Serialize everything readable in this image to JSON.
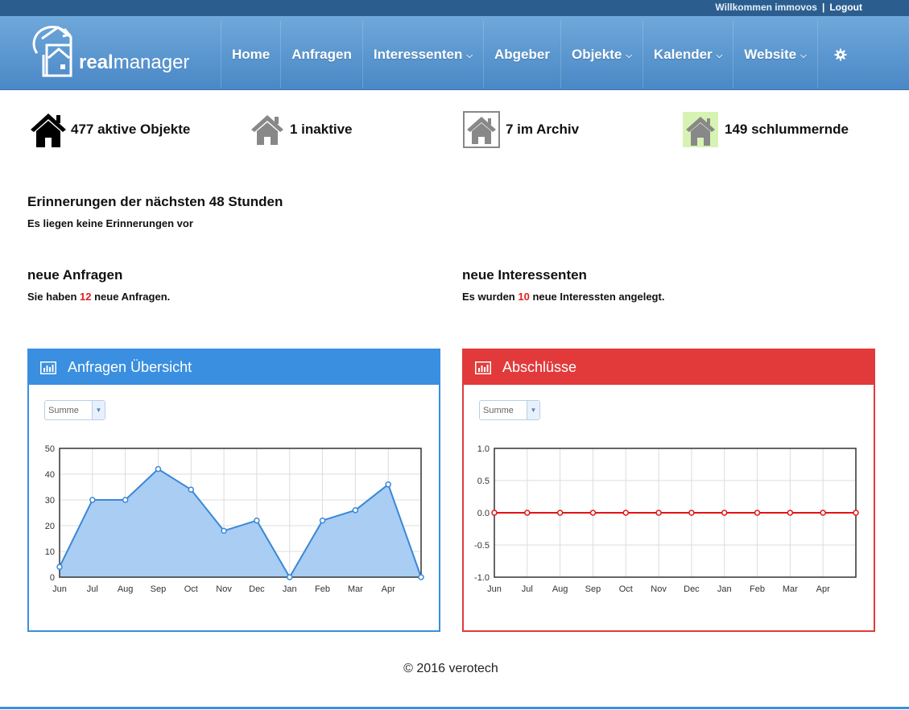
{
  "topbar": {
    "welcome": "Willkommen immovos",
    "separator": "|",
    "logout": "Logout"
  },
  "logo": {
    "prefix": "real",
    "suffix": "manager"
  },
  "nav": [
    {
      "label": "Home",
      "dropdown": false
    },
    {
      "label": "Anfragen",
      "dropdown": false
    },
    {
      "label": "Interessenten",
      "dropdown": true
    },
    {
      "label": "Abgeber",
      "dropdown": false
    },
    {
      "label": "Objekte",
      "dropdown": true
    },
    {
      "label": "Kalender",
      "dropdown": true
    },
    {
      "label": "Website",
      "dropdown": true
    }
  ],
  "nav_chevron": "⌄",
  "settings_icon": "gear-icon",
  "stats": {
    "active": "477 aktive Objekte",
    "inactive": "1 inaktive",
    "archive": "7 im Archiv",
    "sleeping": "149 schlummernde"
  },
  "reminders": {
    "title": "Erinnerungen der nächsten 48 Stunden",
    "text": "Es liegen keine Erinnerungen vor"
  },
  "requests": {
    "title": "neue Anfragen",
    "pre": "Sie haben ",
    "count": "12",
    "post": " neue Anfragen."
  },
  "interested": {
    "title": "neue Interessenten",
    "pre": "Es wurden ",
    "count": "10",
    "post": " neue Interessten angelegt."
  },
  "panels": {
    "requests_title": "Anfragen Übersicht",
    "closings_title": "Abschlüsse",
    "select_value": "Summe"
  },
  "colors": {
    "blue": "#3a8fe0",
    "red": "#e23a3a",
    "fill": "#a9cdf3",
    "line": "#3a87d6"
  },
  "chart_data": [
    {
      "type": "area",
      "x": [
        "Jun",
        "Jul",
        "Aug",
        "Sep",
        "Oct",
        "Nov",
        "Dec",
        "Jan",
        "Feb",
        "Mar",
        "Apr",
        ""
      ],
      "values": [
        4,
        30,
        30,
        42,
        34,
        18,
        22,
        0,
        22,
        26,
        36,
        0
      ],
      "ylim": [
        0,
        50
      ],
      "yticks": [
        "50",
        "40",
        "30",
        "20",
        "10",
        "0"
      ],
      "grid": true
    },
    {
      "type": "line",
      "x": [
        "Jun",
        "Jul",
        "Aug",
        "Sep",
        "Oct",
        "Nov",
        "Dec",
        "Jan",
        "Feb",
        "Mar",
        "Apr",
        ""
      ],
      "values": [
        0,
        0,
        0,
        0,
        0,
        0,
        0,
        0,
        0,
        0,
        0,
        0
      ],
      "ylim": [
        -1.0,
        1.0
      ],
      "yticks": [
        "1.0",
        "0.5",
        "0.0",
        "-0.5",
        "-1.0"
      ],
      "grid": true
    }
  ],
  "footer": "© 2016 verotech"
}
